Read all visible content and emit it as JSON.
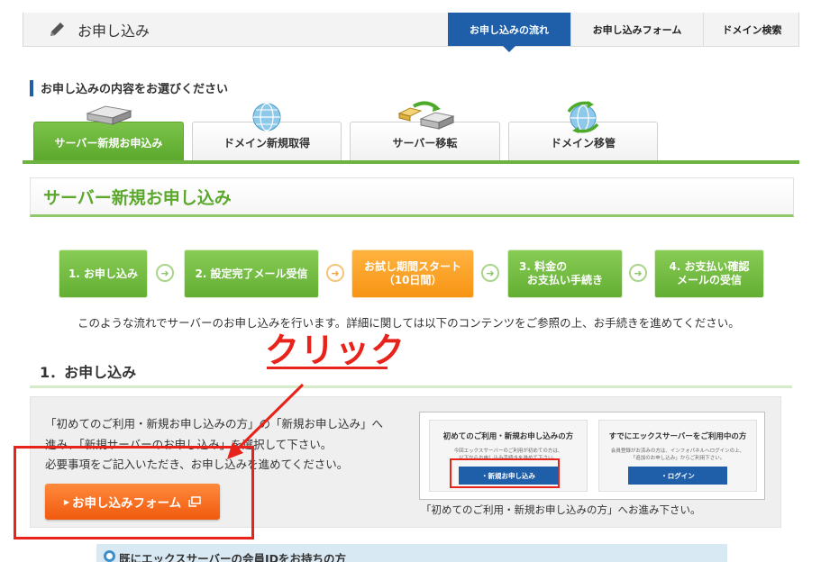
{
  "header": {
    "title": "お申し込み",
    "tabs": [
      {
        "label": "お申し込みの流れ",
        "active": true
      },
      {
        "label": "お申し込みフォーム",
        "active": false
      },
      {
        "label": "ドメイン検索",
        "active": false
      }
    ]
  },
  "section_heading": "お申し込みの内容をお選びください",
  "category_tabs": [
    {
      "label": "サーバー新規お申込み",
      "icon": "server-icon",
      "active": true
    },
    {
      "label": "ドメイン新規取得",
      "icon": "globe-icon",
      "active": false
    },
    {
      "label": "サーバー移転",
      "icon": "server-transfer-icon",
      "active": false
    },
    {
      "label": "ドメイン移管",
      "icon": "globe-transfer-icon",
      "active": false
    }
  ],
  "panel_title": "サーバー新規お申し込み",
  "steps": [
    {
      "line1": "1. お申し込み",
      "line2": ""
    },
    {
      "line1": "2. 設定完了メール受信",
      "line2": ""
    },
    {
      "line1": "お試し期間スタート",
      "line2": "（10日間）"
    },
    {
      "line1": "3. 料金の",
      "line2": "お支払い手続き"
    },
    {
      "line1": "4. お支払い確認",
      "line2": "メールの受信"
    }
  ],
  "flow_description": "このような流れでサーバーのお申し込みを行います。詳細に関しては以下のコンテンツをご参照の上、お手続きを進めてください。",
  "annotation": "クリック",
  "step1_title": "1．お申し込み",
  "instructions": [
    "「初めてのご利用・新規お申し込みの方」の「新規お申し込み」へ",
    "進み、「新規サーバーのお申し込み」を選択して下さい。",
    "必要事項をご記入いただき、お申し込みを進めてください。"
  ],
  "form_button": "お申し込みフォーム",
  "preview": {
    "left_title": "初めてのご利用・新規お申し込みの方",
    "left_text": [
      "今回エックスサーバーのご利用が初めての方は、",
      "以下からお申し込み手続きを進めて下さい。"
    ],
    "left_button": "・新規お申し込み",
    "right_title": "すでにエックスサーバーをご利用中の方",
    "right_text": [
      "会員登録がお済みの方は、インフォパネルへログインの上、",
      "「追加のお申し込み」からご利用下さい。"
    ],
    "right_button": "・ログイン",
    "caption": "「初めてのご利用・新規お申し込みの方」へお進み下さい。"
  },
  "member_box": "既にエックスサーバーの会員IDをお持ちの方",
  "colors": {
    "brand_blue": "#1f5ea8",
    "green": "#5ba82d",
    "orange": "#f79414",
    "annotation_red": "#e8231b"
  }
}
